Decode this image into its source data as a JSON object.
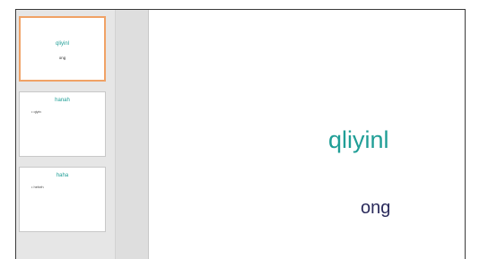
{
  "slides": [
    {
      "title": "qliyinl",
      "subtitle": "ong"
    },
    {
      "title": "hanah",
      "bullet": "qiyin"
    },
    {
      "title": "haha",
      "bullet": "heheh"
    }
  ],
  "current_slide": {
    "title": "qliyinl",
    "subtitle": "ong"
  },
  "colors": {
    "title": "#1f9e96",
    "subtitle": "#2b2b5c",
    "selection": "#f0a266"
  }
}
